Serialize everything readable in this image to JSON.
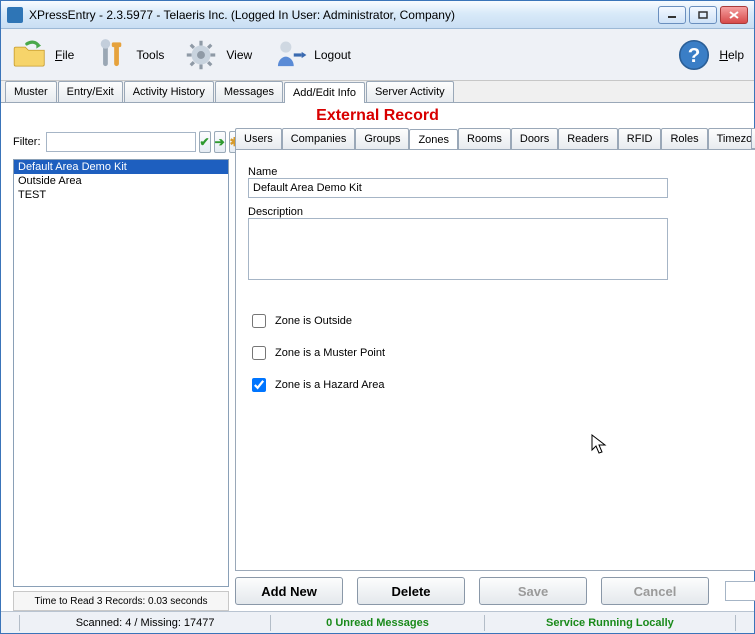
{
  "window": {
    "title": "XPressEntry - 2.3.5977 - Telaeris Inc. (Logged In User: Administrator, Company)"
  },
  "toolbar": {
    "file": "File",
    "tools": "Tools",
    "view": "View",
    "logout": "Logout",
    "help": "Help"
  },
  "main_tabs": [
    "Muster",
    "Entry/Exit",
    "Activity History",
    "Messages",
    "Add/Edit Info",
    "Server Activity"
  ],
  "main_tab_active_index": 4,
  "heading": "External Record",
  "left": {
    "filter_label": "Filter:",
    "filter_value": "",
    "items": [
      "Default Area Demo Kit",
      "Outside Area",
      "TEST"
    ],
    "selected_index": 0,
    "footer": "Time to Read 3 Records: 0.03 seconds"
  },
  "sub_tabs": [
    "Users",
    "Companies",
    "Groups",
    "Zones",
    "Rooms",
    "Doors",
    "Readers",
    "RFID",
    "Roles",
    "Timezones"
  ],
  "sub_tab_active_index": 3,
  "form": {
    "name_label": "Name",
    "name_value": "Default Area Demo Kit",
    "desc_label": "Description",
    "desc_value": "",
    "cb_outside_label": "Zone is Outside",
    "cb_outside": false,
    "cb_muster_label": "Zone is a Muster Point",
    "cb_muster": false,
    "cb_hazard_label": "Zone is a Hazard Area",
    "cb_hazard": true
  },
  "buttons": {
    "add_new": "Add New",
    "delete": "Delete",
    "save": "Save",
    "cancel": "Cancel",
    "count": "3"
  },
  "status": {
    "scanned": "Scanned: 4 / Missing: 17477",
    "unread": "0 Unread Messages",
    "service": "Service Running Locally"
  }
}
